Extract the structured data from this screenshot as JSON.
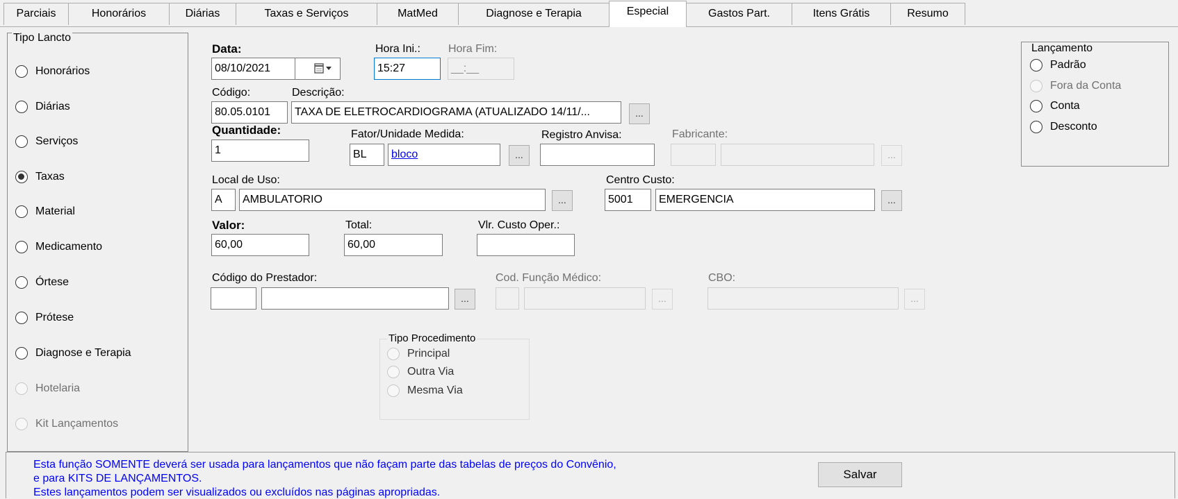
{
  "tabs": [
    "Parciais",
    "Honorários",
    "Diárias",
    "Taxas e Serviços",
    "MatMed",
    "Diagnose e Terapia",
    "Especial",
    "Gastos Part.",
    "Itens Grátis",
    "Resumo"
  ],
  "active_tab": "Especial",
  "tipo_lancto": {
    "legend": "Tipo Lancto",
    "options": [
      "Honorários",
      "Diárias",
      "Serviços",
      "Taxas",
      "Material",
      "Medicamento",
      "Órtese",
      "Prótese",
      "Diagnose e Terapia",
      "Hotelaria",
      "Kit Lançamentos"
    ],
    "selected": "Taxas"
  },
  "form": {
    "data_label": "Data:",
    "data_value": "08/10/2021",
    "hora_ini_label": "Hora Ini.:",
    "hora_ini_value": "15:27",
    "hora_fim_label": "Hora Fim:",
    "hora_fim_value": "__:__",
    "codigo_label": "Código:",
    "codigo_value": "80.05.0101",
    "descricao_label": "Descrição:",
    "descricao_value": "TAXA DE ELETROCARDIOGRAMA (ATUALIZADO 14/11/...",
    "quantidade_label": "Quantidade:",
    "quantidade_value": "1",
    "fator_label": "Fator/Unidade Medida:",
    "fator_code": "BL",
    "fator_desc": "bloco",
    "registro_label": "Registro Anvisa:",
    "registro_value": "",
    "fabricante_label": "Fabricante:",
    "local_label": "Local de Uso:",
    "local_code": "A",
    "local_desc": "AMBULATORIO",
    "centro_label": "Centro Custo:",
    "centro_code": "5001",
    "centro_desc": "EMERGENCIA",
    "valor_label": "Valor:",
    "valor_value": "60,00",
    "total_label": "Total:",
    "total_value": "60,00",
    "custo_label": "Vlr. Custo Oper.:",
    "custo_value": "",
    "prestador_label": "Código do Prestador:",
    "funcao_label": "Cod. Função Médico:",
    "cbo_label": "CBO:",
    "dots": "..."
  },
  "tipo_procedimento": {
    "legend": "Tipo Procedimento",
    "options": [
      "Principal",
      "Outra Via",
      "Mesma Via"
    ]
  },
  "lancamento": {
    "legend": "Lançamento",
    "options": [
      "Padrão",
      "Fora da Conta",
      "Conta",
      "Desconto"
    ]
  },
  "info": {
    "line1": "Esta função SOMENTE deverá ser usada  para lançamentos que não façam parte das tabelas de preços do Convênio,",
    "line2": "e para  KITS DE LANÇAMENTOS.",
    "line3": "Estes lançamentos podem  ser  visualizados ou   excluídos nas páginas apropriadas."
  },
  "salvar_label": "Salvar"
}
